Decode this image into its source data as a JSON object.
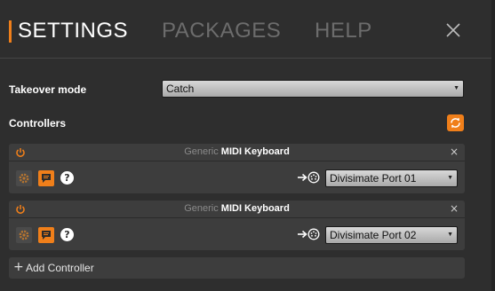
{
  "tabs": {
    "settings": "SETTINGS",
    "packages": "PACKAGES",
    "help": "HELP"
  },
  "takeover": {
    "label": "Takeover mode",
    "value": "Catch"
  },
  "controllers": {
    "label": "Controllers",
    "items": [
      {
        "vendor": "Generic",
        "model": "MIDI Keyboard",
        "port": "Divisimate Port 01"
      },
      {
        "vendor": "Generic",
        "model": "MIDI Keyboard",
        "port": "Divisimate Port 02"
      }
    ],
    "add_label": "Add Controller"
  },
  "icons": {
    "close": "close-icon",
    "refresh": "refresh-icon",
    "power": "power-icon",
    "remove": "remove-icon",
    "gear": "gear-icon",
    "chat": "chat-icon",
    "help": "help-icon",
    "arrow": "arrow-right-icon",
    "midi_port": "midi-port-icon",
    "plus": "plus-icon",
    "help_glyph": "?",
    "remove_glyph": "×",
    "plus_glyph": "+",
    "caret_glyph": "▼"
  },
  "colors": {
    "accent": "#f07f1a",
    "background": "#2e2e2e",
    "card": "#3d3d3d"
  }
}
